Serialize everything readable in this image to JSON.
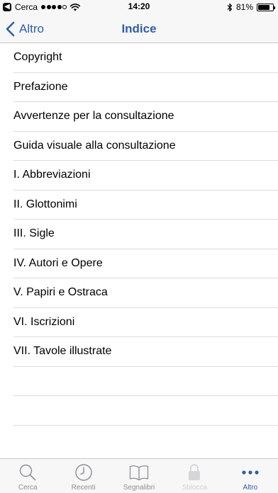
{
  "status_bar": {
    "back_app_glyph": "◀",
    "back_app": "Cerca",
    "time": "14:20",
    "battery_text": "81%",
    "battery_level": 0.81,
    "signal_bars_filled": 4,
    "signal_bars_total": 5
  },
  "nav": {
    "back_label": "Altro",
    "title": "Indice",
    "accent_color": "#2e5ea8"
  },
  "list": {
    "items": [
      "Copyright",
      "Prefazione",
      "Avvertenze per la consultazione",
      "Guida visuale alla consultazione",
      "I. Abbreviazioni",
      "II. Glottonimi",
      "III. Sigle",
      "IV. Autori e Opere",
      "V. Papiri e Ostraca",
      "VI. Iscrizioni",
      "VII. Tavole illustrate"
    ]
  },
  "tabs": {
    "cerca": "Cerca",
    "recenti": "Recenti",
    "segnalibri": "Segnalibri",
    "sblocca": "Sblocca",
    "altro": "Altro",
    "active": "altro"
  }
}
